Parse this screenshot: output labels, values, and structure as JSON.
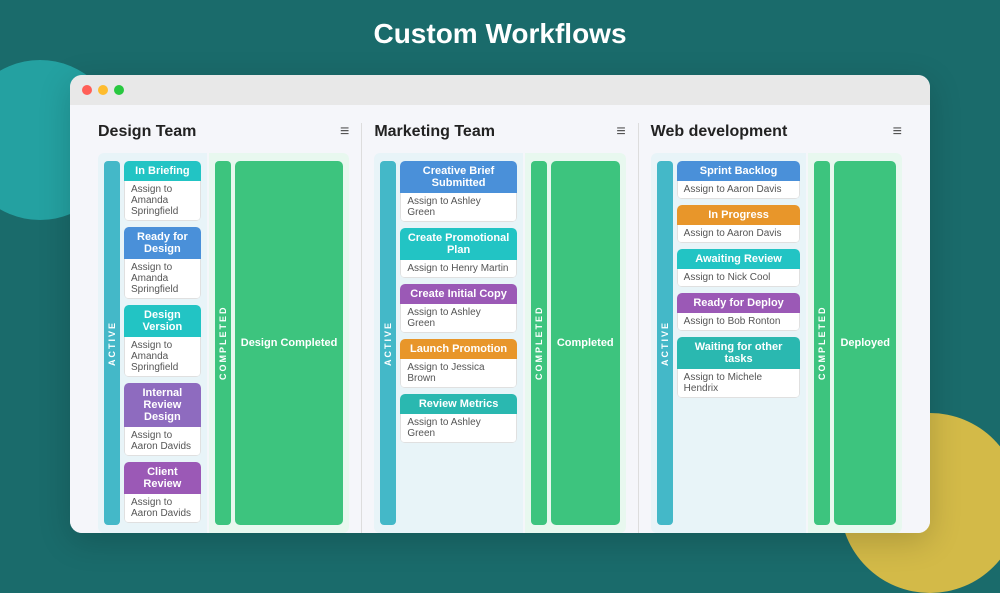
{
  "page": {
    "title": "Custom Workflows",
    "bg_color": "#1a6b6b"
  },
  "columns": [
    {
      "id": "design-team",
      "title": "Design Team",
      "active_label": "ACTIVE",
      "completed_label": "COMPLETED",
      "tasks": [
        {
          "label": "In Briefing",
          "color": "color-cyan",
          "assign": "Assign to Amanda Springfield"
        },
        {
          "label": "Ready for Design",
          "color": "color-blue",
          "assign": "Assign to Amanda Springfield"
        },
        {
          "label": "Design Version",
          "color": "color-cyan",
          "assign": "Assign to Amanda Springfield"
        },
        {
          "label": "Internal Review Design",
          "color": "color-violet",
          "assign": "Assign to Aaron Davids"
        },
        {
          "label": "Client Review",
          "color": "color-purple",
          "assign": "Assign to Aaron Davids"
        }
      ],
      "completed_task": "Design Completed"
    },
    {
      "id": "marketing-team",
      "title": "Marketing Team",
      "active_label": "ACTIVE",
      "completed_label": "COMPLETED",
      "tasks": [
        {
          "label": "Creative Brief Submitted",
          "color": "color-blue",
          "assign": "Assign to Ashley Green"
        },
        {
          "label": "Create Promotional Plan",
          "color": "color-cyan",
          "assign": "Assign to Henry Martin"
        },
        {
          "label": "Create Initial Copy",
          "color": "color-purple",
          "assign": "Assign to Ashley Green"
        },
        {
          "label": "Launch Promotion",
          "color": "color-orange",
          "assign": "Assign to Jessica Brown"
        },
        {
          "label": "Review Metrics",
          "color": "color-teal",
          "assign": "Assign to Ashley Green"
        }
      ],
      "completed_task": "Completed"
    },
    {
      "id": "web-development",
      "title": "Web development",
      "active_label": "ACTIVE",
      "completed_label": "COMPLETED",
      "tasks": [
        {
          "label": "Sprint Backlog",
          "color": "color-blue",
          "assign": "Assign to Aaron Davis"
        },
        {
          "label": "In Progress",
          "color": "color-orange",
          "assign": "Assign to Aaron Davis"
        },
        {
          "label": "Awaiting Review",
          "color": "color-cyan",
          "assign": "Assign to Nick Cool"
        },
        {
          "label": "Ready for Deploy",
          "color": "color-purple",
          "assign": "Assign to Bob Ronton"
        },
        {
          "label": "Waiting for other tasks",
          "color": "color-teal",
          "assign": "Assign to Michele Hendrix"
        }
      ],
      "completed_task": "Deployed"
    }
  ]
}
